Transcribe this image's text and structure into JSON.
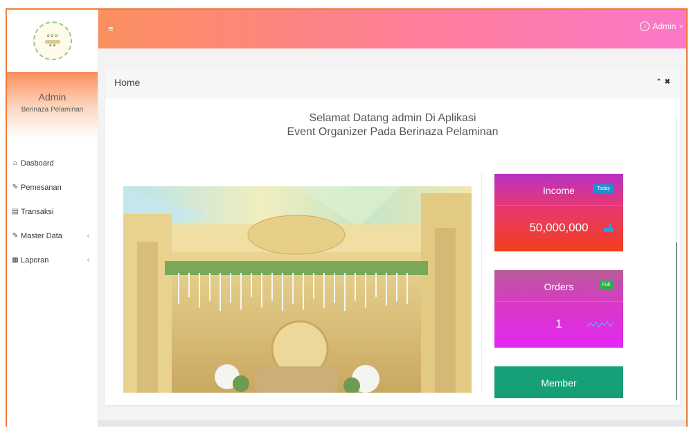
{
  "sidebar": {
    "profile_name": "Admin",
    "profile_sub": "Berinaza Pelaminan",
    "items": [
      {
        "label": "Dasboard",
        "icon": "home-icon",
        "glyph": "🏠︎"
      },
      {
        "label": "Pemesanan",
        "icon": "pencil-icon",
        "glyph": "✎"
      },
      {
        "label": "Transaksi",
        "icon": "book-icon",
        "glyph": "▤"
      },
      {
        "label": "Master Data",
        "icon": "edit-icon",
        "glyph": "✎"
      },
      {
        "label": "Laporan",
        "icon": "calendar-icon",
        "glyph": "▦"
      }
    ]
  },
  "header": {
    "menu_glyph": "≡",
    "user_label": "Admin",
    "user_glyph": "ⓘ",
    "chevron": "∨"
  },
  "panel": {
    "title": "Home",
    "tools": "^ x",
    "welcome_line1": "Selamat Datang admin Di Aplikasi",
    "welcome_line2": "Event Organizer Pada Berinaza Pelaminan"
  },
  "stats": {
    "income": {
      "title": "Income",
      "badge": "Today",
      "value": "50,000,000",
      "badge_color": "#1e8fd6"
    },
    "orders": {
      "title": "Orders",
      "badge": "Full",
      "value": "1",
      "badge_color": "#2ab24a"
    },
    "member": {
      "title": "Member"
    }
  },
  "colors": {
    "accent": "#fb8f5e",
    "pink": "#fb78c9"
  }
}
